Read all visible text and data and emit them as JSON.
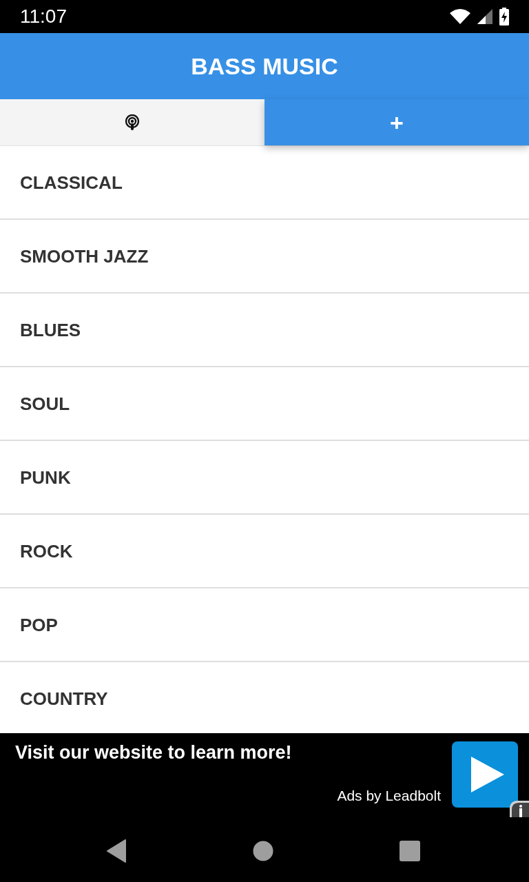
{
  "status_bar": {
    "time": "11:07"
  },
  "app_bar": {
    "title": "BASS MUSIC"
  },
  "tabs": [
    {
      "kind": "icon",
      "selected": false
    },
    {
      "kind": "text",
      "label": "+",
      "selected": true
    }
  ],
  "genres": [
    "CLASSICAL",
    "SMOOTH JAZZ",
    "BLUES",
    "SOUL",
    "PUNK",
    "ROCK",
    "POP",
    "COUNTRY"
  ],
  "ad_banner": {
    "headline": "Visit our website to learn more!",
    "attribution": "Ads by Leadbolt"
  }
}
